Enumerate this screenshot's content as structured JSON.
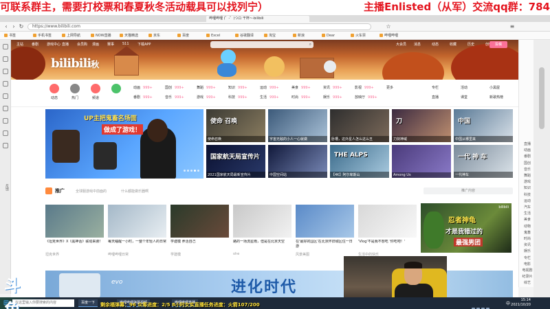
{
  "overlay": {
    "left_text": "可联系群主，需要打校票和春夏秋冬活动载具可以找列宁）",
    "right_text": "主播Enlisted（从军）交流qq群：784",
    "ticker": "剩余福弹幕：96  众筹进度：2/5     8小时女实直播任务进度：火箭107/200"
  },
  "browser": {
    "tab_title": "哔哩哔哩 (゜-゜)つロ 干杯~-bilibili",
    "address": "https://www.bilibili.com",
    "bookmarks": [
      "书签",
      "手机书签",
      "上网导航",
      "NOW直播",
      "天猫精选",
      "京东",
      "百度",
      "Excel",
      "谷歌翻译",
      "淘宝",
      "新浪",
      "Dear",
      "火车票",
      "哔哩哔哩"
    ]
  },
  "site": {
    "logo": "bilibili",
    "season": "秋",
    "nav": [
      "主站",
      "番剧",
      "游戏中心",
      "直播",
      "会员购",
      "漫画",
      "赛事",
      "S11",
      "下载APP"
    ],
    "upload_label": "投稿",
    "user_nav": [
      "大会员",
      "消息",
      "动态",
      "收藏",
      "历史",
      "创作中心"
    ],
    "circle_cats": [
      {
        "label": "动态",
        "color": "#ff6b6b"
      },
      {
        "label": "热门",
        "color": "#888888"
      },
      {
        "label": "频道",
        "color": "#ff6b6b"
      },
      {
        "label": "",
        "color": "#4cc36a"
      }
    ],
    "cat_row1": [
      {
        "name": "动画",
        "count": "999+"
      },
      {
        "name": "番剧",
        "count": "999+"
      },
      {
        "name": "国创",
        "count": "999+"
      },
      {
        "name": "音乐",
        "count": "999+"
      },
      {
        "name": "舞蹈",
        "count": "999+"
      },
      {
        "name": "游戏",
        "count": "999+"
      },
      {
        "name": "知识",
        "count": "999+"
      },
      {
        "name": "科技",
        "count": "999+"
      },
      {
        "name": "运动",
        "count": "999+"
      },
      {
        "name": "生活",
        "count": "999+"
      },
      {
        "name": "美食",
        "count": "999+"
      },
      {
        "name": "时尚",
        "count": "999+"
      },
      {
        "name": "资讯",
        "count": "999+"
      },
      {
        "name": "娱乐",
        "count": "999+"
      },
      {
        "name": "影视",
        "count": "999+"
      },
      {
        "name": "放映厅",
        "count": "999+"
      },
      {
        "name": "更多",
        "count": ""
      }
    ],
    "right_links": [
      "专栏",
      "活动",
      "小黑屋",
      "直播",
      "课堂",
      "新歌热榜"
    ]
  },
  "hero": {
    "title": "UP主把鬼畜名场面",
    "subtitle": "做成了游戏！"
  },
  "tiles": [
    {
      "caption": "使命召唤",
      "big": "使命 召唤",
      "color1": "#3b3a34",
      "color2": "#8b7d60"
    },
    {
      "caption": "宇宙无敌的小人一心就做",
      "big": "",
      "color1": "#3c5a7a",
      "color2": "#aac2d8"
    },
    {
      "caption": "卧槽，这外星人怎么这么丑",
      "big": "",
      "color1": "#2e2e2e",
      "color2": "#7c6a5a"
    },
    {
      "caption": "刀剑神域",
      "big": "刀",
      "color1": "#3b2a40",
      "color2": "#c09070"
    },
    {
      "caption": "中国从哪里来",
      "big": "中国",
      "color1": "#5a7a96",
      "color2": "#d8e0e8"
    },
    {
      "caption": "2021国家航天局最新宣传片",
      "big": "国家航天局宣传片",
      "color1": "#0a1030",
      "color2": "#2a3a6a"
    },
    {
      "caption": "中国空间站",
      "big": "",
      "color1": "#10183a",
      "color2": "#7a8ab8"
    },
    {
      "caption": "【4K】阿尔卑斯山",
      "big": "THE ALPS",
      "color1": "#3a6a8a",
      "color2": "#aacbe0"
    },
    {
      "caption": "Among Us",
      "big": "",
      "color1": "#4a3a7a",
      "color2": "#8a7ac8"
    },
    {
      "caption": "一代神车",
      "big": "一代 神 车",
      "color1": "#7a8a9a",
      "color2": "#dce4ea"
    }
  ],
  "promo": {
    "title": "推广",
    "link1": "全球服游戏中前面的",
    "link2": "什么都能做乐器啊",
    "right": "推广内容",
    "cards": [
      {
        "title": "《坦克世界》X《黑神话》联动来袭！",
        "up": "坦克世界",
        "color1": "#5a7a8a",
        "color2": "#9ab0a0"
      },
      {
        "title": "每天睡醒一小时，一整个年轻人的日常",
        "up": "哔哩哔哩日常",
        "color1": "#a4b8c8",
        "color2": "#e8eef2"
      },
      {
        "title": "学建模 养活自己",
        "up": "学建模",
        "color1": "#2a3a2a",
        "color2": "#6a4a3a"
      },
      {
        "title": "路的一场流星雨，但是在北京天空",
        "up": "ohe",
        "color1": "#c8c8c8",
        "color2": "#f2f2f2"
      },
      {
        "title": "在'最好的园区'在北京怀旧城区住一日游",
        "up": "风景美图",
        "color1": "#5a8ac8",
        "color2": "#a8c8e8"
      },
      {
        "title": "'Vlog'不是我不想吃 '你吃吧！'",
        "up": "生活中的快乐",
        "color1": "#d8d8d8",
        "color2": "#f8f8f8"
      }
    ],
    "ad": {
      "t1": "忍者神龟",
      "t2": "才是我错过的",
      "t3": "最强男团",
      "badge": "bilibili"
    }
  },
  "feature": {
    "evo": "evo",
    "big": "进化时代"
  },
  "rightrail": [
    "直播",
    "动画",
    "番剧",
    "国创",
    "音乐",
    "舞蹈",
    "游戏",
    "知识",
    "科技",
    "运动",
    "汽车",
    "生活",
    "美食",
    "动物",
    "鬼畜",
    "时尚",
    "资讯",
    "娱乐",
    "专栏",
    "电影",
    "电视剧",
    "纪录片",
    "综艺"
  ],
  "leftrail": {
    "label": "反馈"
  },
  "taskbar": {
    "search": "在这里输入你要搜索的内容",
    "buttons": [
      "百度一下",
      "哔哩哔哩弹幕视频",
      "哔哩哔哩直播"
    ],
    "ime": "中",
    "time": "15:14",
    "date": "2021/10/20"
  }
}
